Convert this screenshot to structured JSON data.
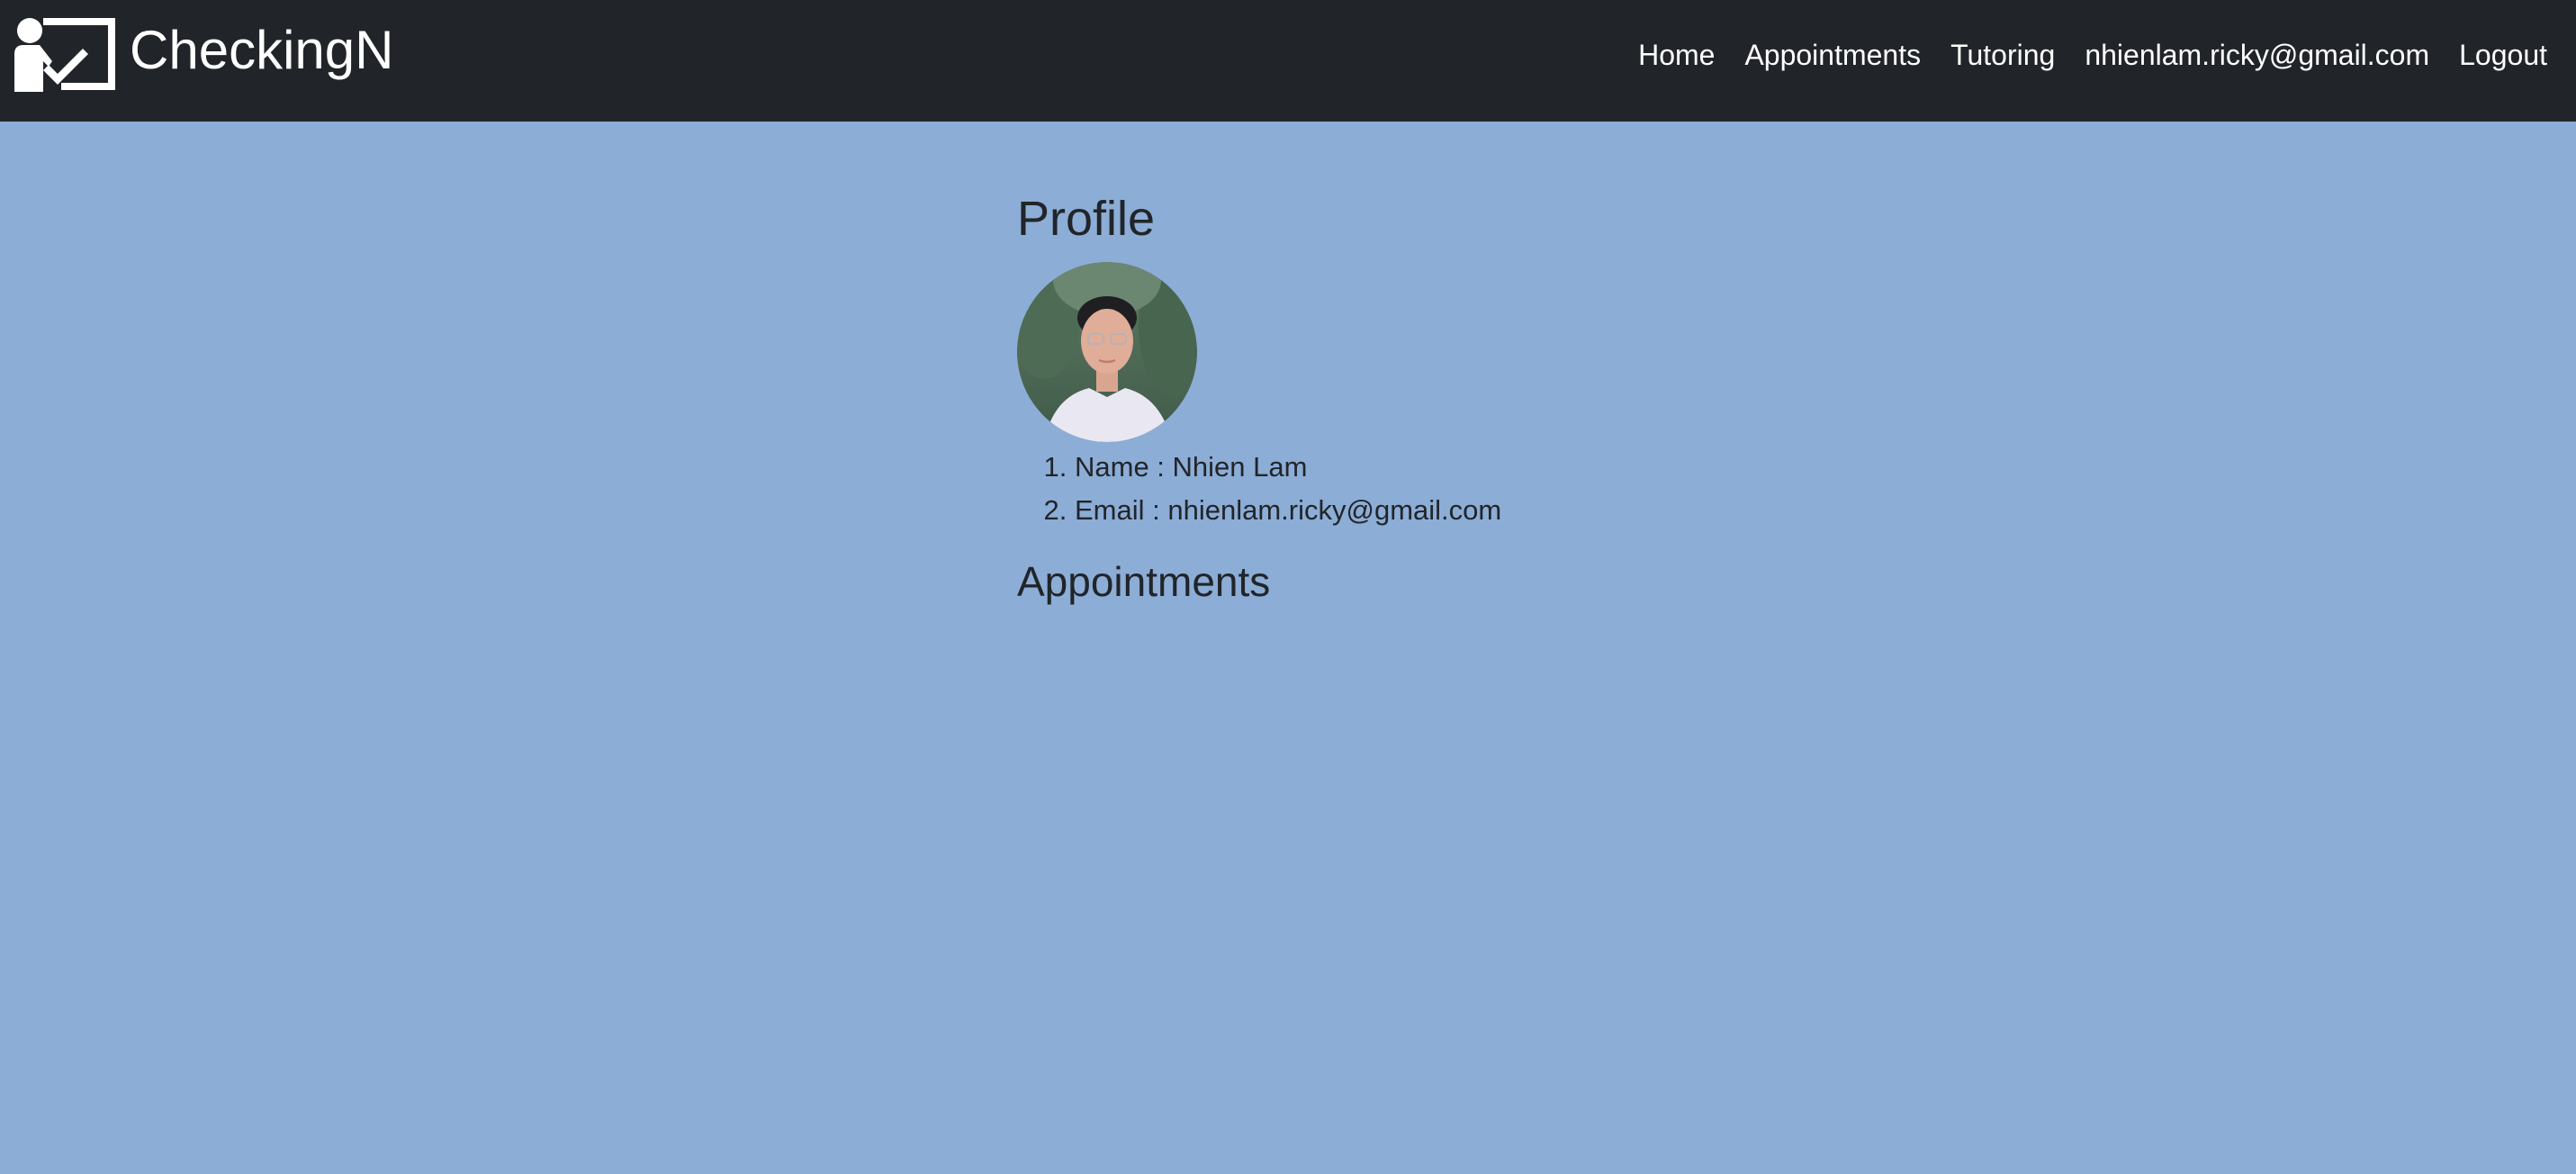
{
  "app": {
    "brand_name": "CheckingN",
    "brand_logo_icon": "teacher-board-check-icon"
  },
  "nav": {
    "items": [
      {
        "label": "Home"
      },
      {
        "label": "Appointments"
      },
      {
        "label": "Tutoring"
      },
      {
        "label": "nhienlam.ricky@gmail.com"
      },
      {
        "label": "Logout"
      }
    ]
  },
  "profile": {
    "title": "Profile",
    "avatar_alt": "profile-photo",
    "fields": [
      {
        "text": "Name : Nhien Lam"
      },
      {
        "text": "Email : nhienlam.ricky@gmail.com"
      }
    ]
  },
  "appointments": {
    "title": "Appointments"
  },
  "colors": {
    "navbar_bg": "#212529",
    "page_bg": "#8cadd6",
    "text": "#212529",
    "nav_text": "#ffffff"
  }
}
